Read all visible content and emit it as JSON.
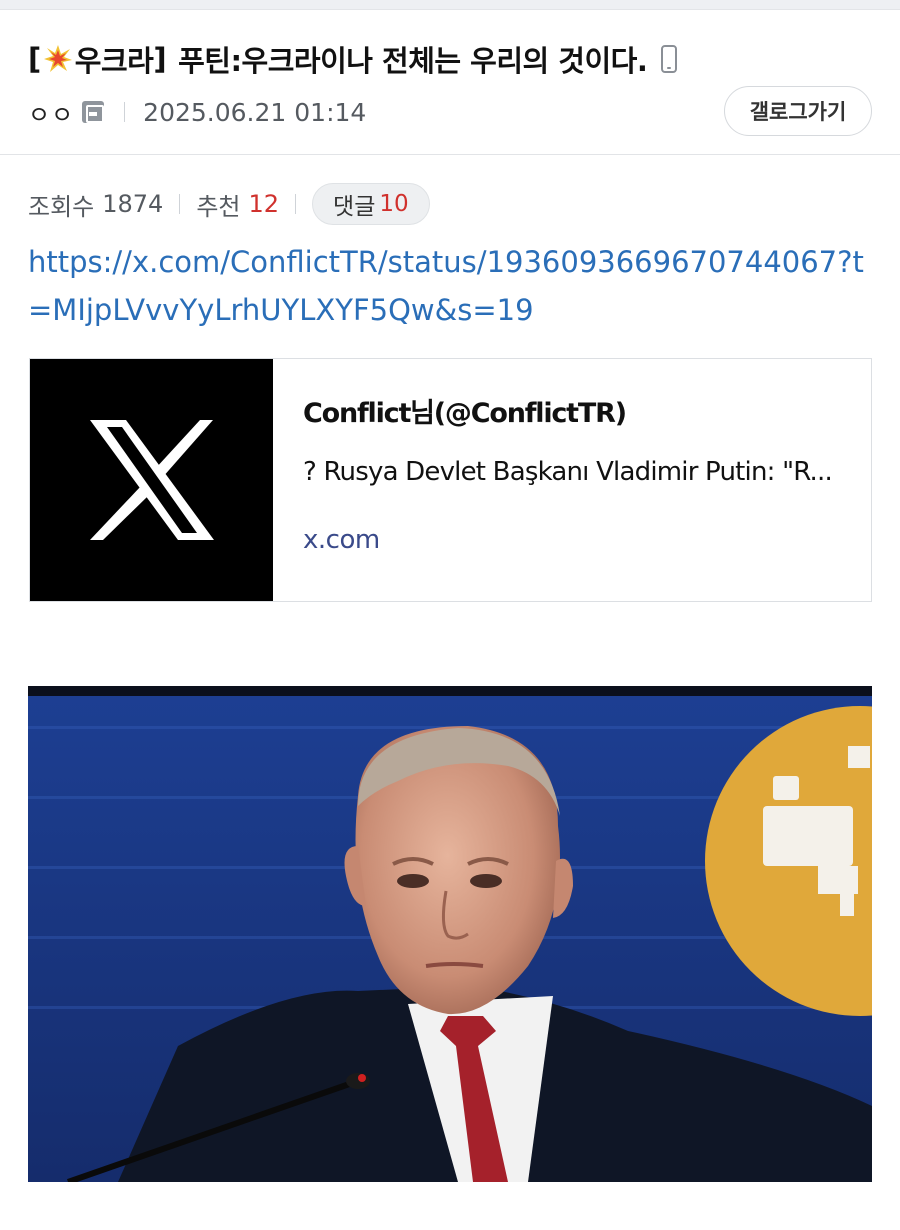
{
  "post": {
    "title_prefix_open": "[",
    "category": "우크라",
    "title_prefix_close": "]",
    "title": "푸틴:우크라이나 전체는 우리의 것이다.",
    "author_nick": "ㅇㅇ",
    "date": "2025.06.21 01:14",
    "gallery_button": "갤로그가기"
  },
  "stats": {
    "views_label": "조회수",
    "views": "1874",
    "recommend_label": "추천",
    "recommend": "12",
    "comments_label": "댓글",
    "comments": "10"
  },
  "body": {
    "link": "https://x.com/ConflictTR/status/1936093669670744067?t=MIjpLVvvYyLrhUYLXYF5Qw&s=19"
  },
  "link_card": {
    "title": "Conflict님(@ConflictTR)",
    "description": "? Rusya Devlet Başkanı Vladimir Putin: \"R...",
    "domain": "x.com",
    "thumb_icon": "x-logo-icon"
  },
  "colors": {
    "link": "#2a6eb8",
    "accent_red": "#d0312d",
    "photo_background": "#1a3a8a"
  }
}
